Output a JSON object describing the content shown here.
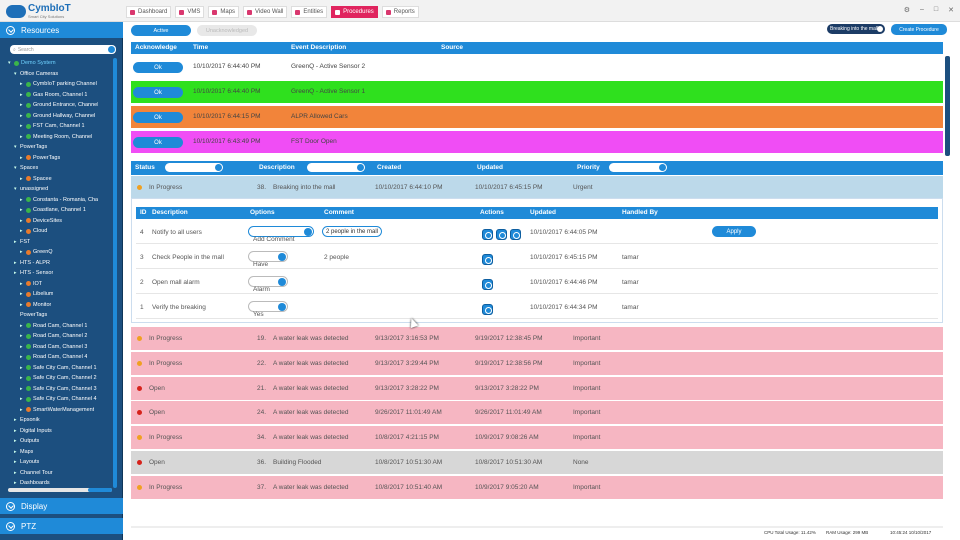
{
  "app": {
    "name": "CymbIoT",
    "subtitle": "Smart City Solutions"
  },
  "nav": [
    {
      "label": "Dashboard",
      "icon": "dashboard-icon",
      "active": false
    },
    {
      "label": "VMS",
      "icon": "video-icon",
      "active": false
    },
    {
      "label": "Maps",
      "icon": "map-pin-icon",
      "active": false
    },
    {
      "label": "Video Wall",
      "icon": "video-wall-icon",
      "active": false
    },
    {
      "label": "Entities",
      "icon": "entities-icon",
      "active": false
    },
    {
      "label": "Procedures",
      "icon": "procedures-icon",
      "active": true
    },
    {
      "label": "Reports",
      "icon": "chart-icon",
      "active": false
    }
  ],
  "window_controls": {
    "settings": "⚙",
    "minimize": "–",
    "maximize": "□",
    "close": "✕"
  },
  "sidebar": {
    "resources_label": "Resources",
    "search_placeholder": "Search",
    "display_label": "Display",
    "ptz_label": "PTZ",
    "tree": [
      {
        "label": "Demo System",
        "indent": 0,
        "dot": "g",
        "arrow": "▾",
        "selected": true
      },
      {
        "label": "Office Cameras",
        "indent": 1,
        "dot": "",
        "arrow": "▾"
      },
      {
        "label": "CymbIoT parking Channel",
        "indent": 2,
        "dot": "g",
        "arrow": "▸"
      },
      {
        "label": "Gas Room, Channel 1",
        "indent": 2,
        "dot": "g",
        "arrow": "▸"
      },
      {
        "label": "Ground Entrance, Channel",
        "indent": 2,
        "dot": "g",
        "arrow": "▸"
      },
      {
        "label": "Ground Hallway, Channel",
        "indent": 2,
        "dot": "g",
        "arrow": "▸"
      },
      {
        "label": "FST Cam, Channel 1",
        "indent": 2,
        "dot": "g",
        "arrow": "▸"
      },
      {
        "label": "Meeting Room, Channel",
        "indent": 2,
        "dot": "g",
        "arrow": "▸"
      },
      {
        "label": "PowerTags",
        "indent": 1,
        "dot": "",
        "arrow": "▾"
      },
      {
        "label": "PowerTags",
        "indent": 2,
        "dot": "o",
        "arrow": "▸"
      },
      {
        "label": "Spaces",
        "indent": 1,
        "dot": "",
        "arrow": "▾"
      },
      {
        "label": "Spacee",
        "indent": 2,
        "dot": "o",
        "arrow": "▸"
      },
      {
        "label": "unassigned",
        "indent": 1,
        "dot": "",
        "arrow": "▾"
      },
      {
        "label": "Constanta - Romania, Cha",
        "indent": 2,
        "dot": "g",
        "arrow": "▸"
      },
      {
        "label": "Coastlane, Channel 1",
        "indent": 2,
        "dot": "g",
        "arrow": "▸"
      },
      {
        "label": "DeviceSites",
        "indent": 2,
        "dot": "o",
        "arrow": "▸"
      },
      {
        "label": "Cloud",
        "indent": 2,
        "dot": "o",
        "arrow": "▸"
      },
      {
        "label": "FST",
        "indent": 1,
        "dot": "",
        "arrow": "▸"
      },
      {
        "label": "GreenQ",
        "indent": 2,
        "dot": "o",
        "arrow": "▸"
      },
      {
        "label": "HTS - ALPR",
        "indent": 1,
        "dot": "",
        "arrow": "▸"
      },
      {
        "label": "HTS - Sensor",
        "indent": 1,
        "dot": "",
        "arrow": "▸"
      },
      {
        "label": "IOT",
        "indent": 2,
        "dot": "o",
        "arrow": "▸"
      },
      {
        "label": "Libelium",
        "indent": 2,
        "dot": "o",
        "arrow": "▸"
      },
      {
        "label": "Monitor",
        "indent": 2,
        "dot": "o",
        "arrow": "▸"
      },
      {
        "label": "PowerTags",
        "indent": 1,
        "dot": "",
        "arrow": ""
      },
      {
        "label": "Road Cam, Channel 1",
        "indent": 2,
        "dot": "g",
        "arrow": "▸"
      },
      {
        "label": "Road Cam, Channel 2",
        "indent": 2,
        "dot": "g",
        "arrow": "▸"
      },
      {
        "label": "Road Cam, Channel 3",
        "indent": 2,
        "dot": "g",
        "arrow": "▸"
      },
      {
        "label": "Road Cam, Channel 4",
        "indent": 2,
        "dot": "g",
        "arrow": "▸"
      },
      {
        "label": "Safe City Cam, Channel 1",
        "indent": 2,
        "dot": "g",
        "arrow": "▸"
      },
      {
        "label": "Safe City Cam, Channel 2",
        "indent": 2,
        "dot": "g",
        "arrow": "▸"
      },
      {
        "label": "Safe City Cam, Channel 3",
        "indent": 2,
        "dot": "g",
        "arrow": "▸"
      },
      {
        "label": "Safe City Cam, Channel 4",
        "indent": 2,
        "dot": "g",
        "arrow": "▸"
      },
      {
        "label": "SmartWaterManagement",
        "indent": 2,
        "dot": "o",
        "arrow": "▸"
      },
      {
        "label": "Epsonik",
        "indent": 1,
        "dot": "",
        "arrow": "▸"
      },
      {
        "label": "Digital Inputs",
        "indent": 1,
        "dot": "",
        "arrow": "▸"
      },
      {
        "label": "Outputs",
        "indent": 1,
        "dot": "",
        "arrow": "▸"
      },
      {
        "label": "Maps",
        "indent": 1,
        "dot": "",
        "arrow": "▸"
      },
      {
        "label": "Layouts",
        "indent": 1,
        "dot": "",
        "arrow": "▸"
      },
      {
        "label": "Channel Tour",
        "indent": 1,
        "dot": "",
        "arrow": "▸"
      },
      {
        "label": "Dashboards",
        "indent": 1,
        "dot": "",
        "arrow": "▸"
      }
    ]
  },
  "toolbar": {
    "active_label": "Active",
    "unacked_label": "Unacknowledged",
    "procedure_select": "Breaking into the mall",
    "create_label": "Create Procedure"
  },
  "alarms": {
    "headers": [
      "Acknowledge",
      "Time",
      "Event Description",
      "Source"
    ],
    "rows": [
      {
        "ack": "Ok",
        "time": "10/10/2017 6:44:40 PM",
        "desc": "GreenQ - Active Sensor 2",
        "color": "#ffffff"
      },
      {
        "ack": "Ok",
        "time": "10/10/2017 6:44:40 PM",
        "desc": "GreenQ - Active Sensor 1",
        "color": "#2fe01e"
      },
      {
        "ack": "Ok",
        "time": "10/10/2017 6:44:15 PM",
        "desc": "ALPR Allowed Cars",
        "color": "#f2843a"
      },
      {
        "ack": "Ok",
        "time": "10/10/2017 6:43:49 PM",
        "desc": "FST Door Open",
        "color": "#f04df5"
      }
    ]
  },
  "filters": {
    "status": "Status",
    "description": "Description",
    "created": "Created",
    "updated": "Updated",
    "priority": "Priority"
  },
  "procedures_top": [
    {
      "status": "In Progress",
      "dot": "or",
      "id": "38.",
      "desc": "Breaking into the mall",
      "created": "10/10/2017 6:44:10 PM",
      "updated": "10/10/2017 6:45:15 PM",
      "priority": "Urgent",
      "bg": "blue"
    }
  ],
  "detail": {
    "headers": [
      "ID",
      "Description",
      "Options",
      "Comment",
      "Actions",
      "Updated",
      "Handled By"
    ],
    "apply_label": "Apply",
    "rows": [
      {
        "id": "4",
        "desc": "Notify to all users",
        "option": "Add Comment",
        "option_active": true,
        "comment": "2 people in the mall",
        "comment_box": true,
        "actions": 3,
        "updated": "10/10/2017 6:44:05 PM",
        "handled": ""
      },
      {
        "id": "3",
        "desc": "Check People in the mall",
        "option": "Have",
        "option_active": false,
        "comment": "2 people",
        "comment_box": false,
        "actions": 1,
        "updated": "10/10/2017 6:45:15 PM",
        "handled": "tamar"
      },
      {
        "id": "2",
        "desc": "Open mall alarm",
        "option": "Alarm",
        "option_active": false,
        "comment": "",
        "comment_box": false,
        "actions": 1,
        "updated": "10/10/2017 6:44:46 PM",
        "handled": "tamar"
      },
      {
        "id": "1",
        "desc": "Verify the breaking",
        "option": "Yes",
        "option_active": false,
        "comment": "",
        "comment_box": false,
        "actions": 1,
        "updated": "10/10/2017 6:44:34 PM",
        "handled": "tamar"
      }
    ]
  },
  "procedures": [
    {
      "status": "In Progress",
      "dot": "or",
      "id": "19.",
      "desc": "A water leak was detected",
      "created": "9/13/2017 3:16:53 PM",
      "updated": "9/19/2017 12:38:45 PM",
      "priority": "Important",
      "bg": "pink"
    },
    {
      "status": "In Progress",
      "dot": "or",
      "id": "22.",
      "desc": "A water leak was detected",
      "created": "9/13/2017 3:29:44 PM",
      "updated": "9/19/2017 12:38:56 PM",
      "priority": "Important",
      "bg": "pink"
    },
    {
      "status": "Open",
      "dot": "rd",
      "id": "21.",
      "desc": "A water leak was detected",
      "created": "9/13/2017 3:28:22 PM",
      "updated": "9/13/2017 3:28:22 PM",
      "priority": "Important",
      "bg": "pink"
    },
    {
      "status": "Open",
      "dot": "rd",
      "id": "24.",
      "desc": "A water leak was detected",
      "created": "9/26/2017 11:01:49 AM",
      "updated": "9/26/2017 11:01:49 AM",
      "priority": "Important",
      "bg": "pink"
    },
    {
      "status": "In Progress",
      "dot": "or",
      "id": "34.",
      "desc": "A water leak was detected",
      "created": "10/8/2017 4:21:15 PM",
      "updated": "10/9/2017 9:08:26 AM",
      "priority": "Important",
      "bg": "pink"
    },
    {
      "status": "Open",
      "dot": "rd",
      "id": "36.",
      "desc": "Building Flooded",
      "created": "10/8/2017 10:51:30 AM",
      "updated": "10/8/2017 10:51:30 AM",
      "priority": "None",
      "bg": "grey"
    },
    {
      "status": "In Progress",
      "dot": "or",
      "id": "37.",
      "desc": "A water leak was detected",
      "created": "10/8/2017 10:51:40 AM",
      "updated": "10/9/2017 9:05:20 AM",
      "priority": "Important",
      "bg": "pink"
    }
  ],
  "statusbar": {
    "cpu": "CPU Total Usage: 11.42%",
    "ram": "RAM Usage: 299 MB",
    "time": "10:45:24 10/10/2017"
  }
}
